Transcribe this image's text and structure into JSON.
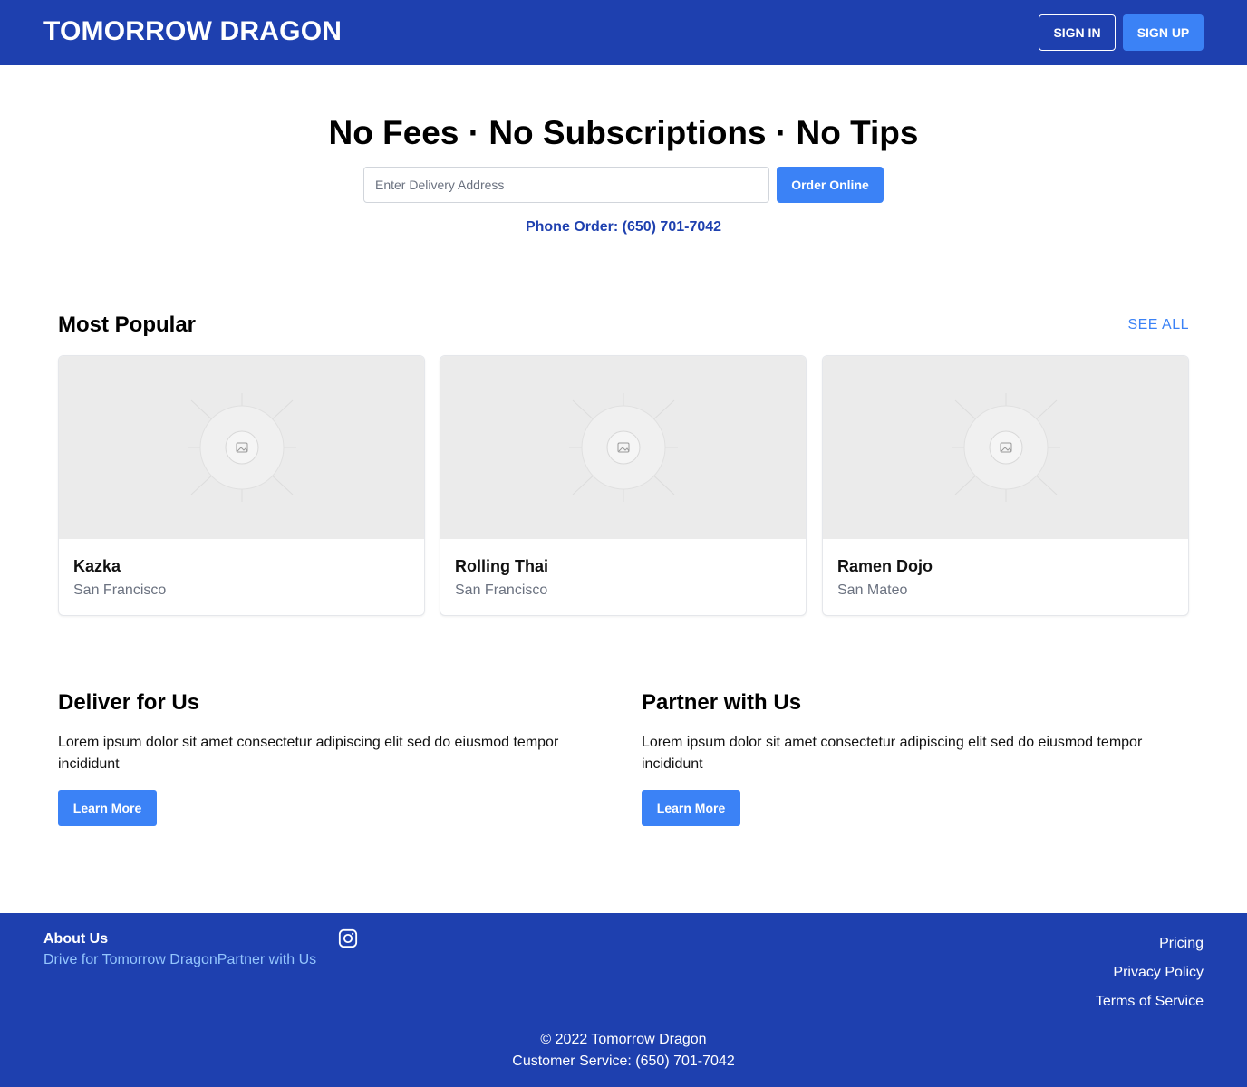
{
  "header": {
    "brand": "TOMORROW DRAGON",
    "sign_in": "SIGN IN",
    "sign_up": "SIGN UP"
  },
  "hero": {
    "title": "No Fees · No Subscriptions · No Tips",
    "address_placeholder": "Enter Delivery Address",
    "address_value": "",
    "order_button": "Order Online",
    "phone_order": "Phone Order: (650) 701-7042"
  },
  "popular": {
    "title": "Most Popular",
    "see_all": "SEE ALL",
    "cards": [
      {
        "name": "Kazka",
        "city": "San Francisco"
      },
      {
        "name": "Rolling Thai",
        "city": "San Francisco"
      },
      {
        "name": "Ramen Dojo",
        "city": "San Mateo"
      }
    ]
  },
  "promos": [
    {
      "title": "Deliver for Us",
      "text": "Lorem ipsum dolor sit amet consectetur adipiscing elit sed do eiusmod tempor incididunt",
      "button": "Learn More"
    },
    {
      "title": "Partner with Us",
      "text": "Lorem ipsum dolor sit amet consectetur adipiscing elit sed do eiusmod tempor incididunt",
      "button": "Learn More"
    }
  ],
  "footer": {
    "about_title": "About Us",
    "link_drive": "Drive for Tomorrow Dragon",
    "link_partner": "Partner with Us",
    "social_icon": "instagram-icon",
    "links": [
      "Pricing",
      "Privacy Policy",
      "Terms of Service"
    ],
    "copyright": "© 2022 Tomorrow Dragon",
    "customer_service": "Customer Service: (650) 701-7042"
  },
  "colors": {
    "primary_dark": "#1e40af",
    "accent": "#3b82f6",
    "link_light": "#93c5fd",
    "placeholder_bg": "#ebebeb"
  }
}
